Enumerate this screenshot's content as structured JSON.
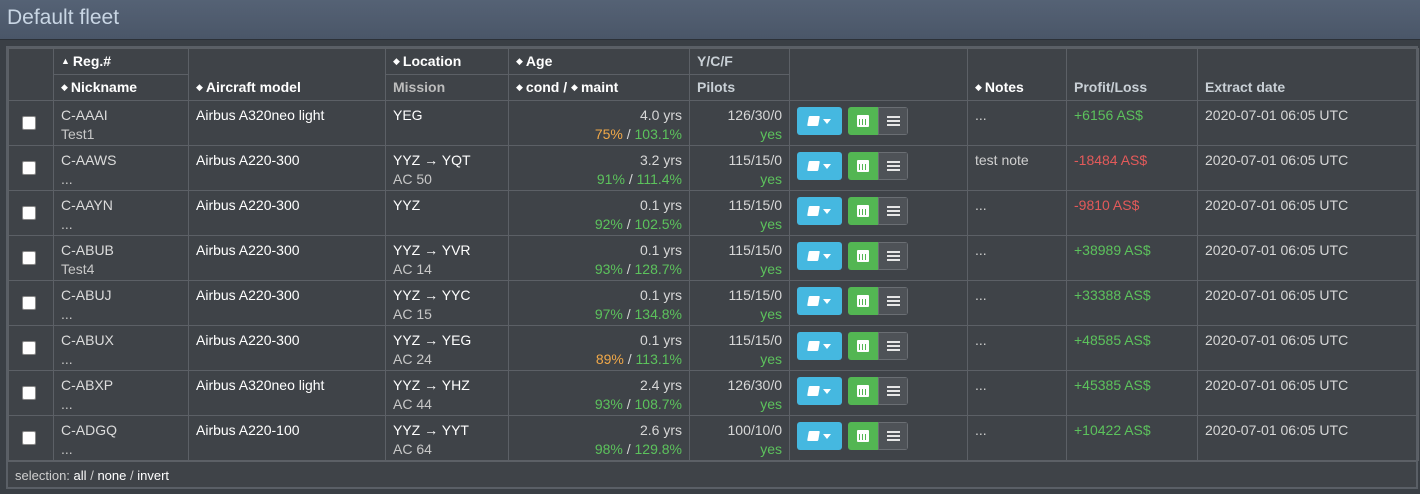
{
  "page": {
    "title": "Default fleet"
  },
  "headers": {
    "reg": "Reg.#",
    "nickname": "Nickname",
    "model": "Aircraft model",
    "location": "Location",
    "mission": "Mission",
    "age": "Age",
    "cond": "cond",
    "slash": "/",
    "maint": "maint",
    "ycf": "Y/C/F",
    "pilots": "Pilots",
    "notes": "Notes",
    "profit": "Profit/Loss",
    "extract": "Extract date"
  },
  "rows": [
    {
      "reg": "C-AAAI",
      "nick": "Test1",
      "model": "Airbus A320neo light",
      "loc": "YEG",
      "mission": "",
      "age": "4.0 yrs",
      "cond": "75%",
      "cond_color": "orange",
      "maint": "103.1%",
      "ycf": "126/30/0",
      "pilots": "yes",
      "notes": "...",
      "profit": "+6156 AS$",
      "profit_color": "green",
      "extract": "2020-07-01 06:05 UTC"
    },
    {
      "reg": "C-AAWS",
      "nick": "...",
      "model": "Airbus A220-300",
      "loc": "YYZ → YQT",
      "mission": "AC 50",
      "age": "3.2 yrs",
      "cond": "91%",
      "cond_color": "green",
      "maint": "111.4%",
      "ycf": "115/15/0",
      "pilots": "yes",
      "notes": "test note",
      "profit": "-18484 AS$",
      "profit_color": "red",
      "extract": "2020-07-01 06:05 UTC"
    },
    {
      "reg": "C-AAYN",
      "nick": "...",
      "model": "Airbus A220-300",
      "loc": "YYZ",
      "mission": "",
      "age": "0.1 yrs",
      "cond": "92%",
      "cond_color": "green",
      "maint": "102.5%",
      "ycf": "115/15/0",
      "pilots": "yes",
      "notes": "...",
      "profit": "-9810 AS$",
      "profit_color": "red",
      "extract": "2020-07-01 06:05 UTC"
    },
    {
      "reg": "C-ABUB",
      "nick": "Test4",
      "model": "Airbus A220-300",
      "loc": "YYZ → YVR",
      "mission": "AC 14",
      "age": "0.1 yrs",
      "cond": "93%",
      "cond_color": "green",
      "maint": "128.7%",
      "ycf": "115/15/0",
      "pilots": "yes",
      "notes": "...",
      "profit": "+38989 AS$",
      "profit_color": "green",
      "extract": "2020-07-01 06:05 UTC"
    },
    {
      "reg": "C-ABUJ",
      "nick": "...",
      "model": "Airbus A220-300",
      "loc": "YYZ → YYC",
      "mission": "AC 15",
      "age": "0.1 yrs",
      "cond": "97%",
      "cond_color": "green",
      "maint": "134.8%",
      "ycf": "115/15/0",
      "pilots": "yes",
      "notes": "...",
      "profit": "+33388 AS$",
      "profit_color": "green",
      "extract": "2020-07-01 06:05 UTC"
    },
    {
      "reg": "C-ABUX",
      "nick": "...",
      "model": "Airbus A220-300",
      "loc": "YYZ → YEG",
      "mission": "AC 24",
      "age": "0.1 yrs",
      "cond": "89%",
      "cond_color": "orange",
      "maint": "113.1%",
      "ycf": "115/15/0",
      "pilots": "yes",
      "notes": "...",
      "profit": "+48585 AS$",
      "profit_color": "green",
      "extract": "2020-07-01 06:05 UTC"
    },
    {
      "reg": "C-ABXP",
      "nick": "...",
      "model": "Airbus A320neo light",
      "loc": "YYZ → YHZ",
      "mission": "AC 44",
      "age": "2.4 yrs",
      "cond": "93%",
      "cond_color": "green",
      "maint": "108.7%",
      "ycf": "126/30/0",
      "pilots": "yes",
      "notes": "...",
      "profit": "+45385 AS$",
      "profit_color": "green",
      "extract": "2020-07-01 06:05 UTC"
    },
    {
      "reg": "C-ADGQ",
      "nick": "...",
      "model": "Airbus A220-100",
      "loc": "YYZ → YYT",
      "mission": "AC 64",
      "age": "2.6 yrs",
      "cond": "98%",
      "cond_color": "green",
      "maint": "129.8%",
      "ycf": "100/10/0",
      "pilots": "yes",
      "notes": "...",
      "profit": "+10422 AS$",
      "profit_color": "green",
      "extract": "2020-07-01 06:05 UTC"
    }
  ],
  "footer": {
    "label": "selection:",
    "all": "all",
    "sep1": "/",
    "none": "none",
    "sep2": "/",
    "invert": "invert"
  },
  "icons": {
    "book": "book-icon",
    "caret": "caret-down-icon",
    "calendar": "calendar-icon",
    "list": "list-icon",
    "sort": "sort-icon"
  }
}
